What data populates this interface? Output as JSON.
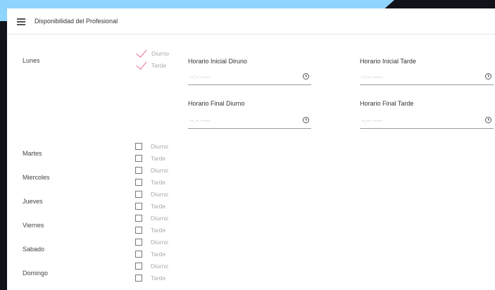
{
  "app": {
    "title": "Disponibilidad del Profesional",
    "menu_icon": "menu-icon"
  },
  "shift_labels": {
    "morning": "Diurno",
    "afternoon": "Tarde"
  },
  "days": [
    {
      "name": "Lunes",
      "morning_checked": true,
      "afternoon_checked": true
    },
    {
      "name": "Martes",
      "morning_checked": false,
      "afternoon_checked": false
    },
    {
      "name": "Miercoles",
      "morning_checked": false,
      "afternoon_checked": false
    },
    {
      "name": "Jueves",
      "morning_checked": false,
      "afternoon_checked": false
    },
    {
      "name": "Viernes",
      "morning_checked": false,
      "afternoon_checked": false
    },
    {
      "name": "Sabado",
      "morning_checked": false,
      "afternoon_checked": false
    },
    {
      "name": "Domingo",
      "morning_checked": false,
      "afternoon_checked": false
    }
  ],
  "time_fields": {
    "start_morning": {
      "label": "Horario Inicial Diruno",
      "value": "--:-- -----"
    },
    "start_afternoon": {
      "label": "Horario Inicial Tarde",
      "value": "--:-- -----"
    },
    "end_morning": {
      "label": "Horario Final Diurno",
      "value": "--:-- -----"
    },
    "end_afternoon": {
      "label": "Horario Final Tarde",
      "value": "--:-- -----"
    }
  },
  "colors": {
    "check_accent": "#e86b8a",
    "page_bg": "#12131a",
    "decor": "#8fd3ff"
  }
}
